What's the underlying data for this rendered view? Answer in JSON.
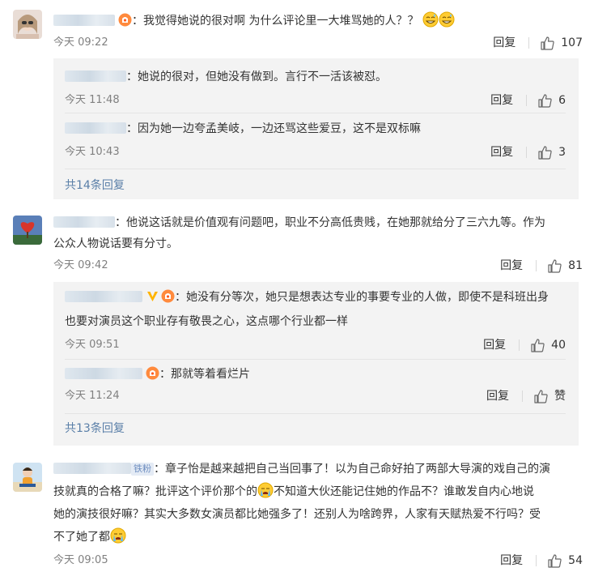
{
  "comments": [
    {
      "text": "我觉得她说的很对啊 为什么评论里一大堆骂她的人？？",
      "time": "今天 09:22",
      "reply_label": "回复",
      "likes": "107",
      "replies": [
        {
          "text": "她说的很对，但她没有做到。言行不一活该被怼。",
          "time": "今天 11:48",
          "reply_label": "回复",
          "likes": "6"
        },
        {
          "text": "因为她一边夸孟美岐，一边还骂这些爱豆，这不是双标嘛",
          "time": "今天 10:43",
          "reply_label": "回复",
          "likes": "3"
        }
      ],
      "more": "共14条回复"
    },
    {
      "text_line1": "他说这话就是价值观有问题吧，职业不分高低贵贱，在她那就给分了三六九等。作为",
      "text_line2": "公众人物说话要有分寸。",
      "time": "今天 09:42",
      "reply_label": "回复",
      "likes": "81",
      "replies": [
        {
          "text_line1": "她没有分等次，她只是想表达专业的事要专业的人做，即使不是科班出身",
          "text_line2": "也要对演员这个职业存有敬畏之心，这点哪个行业都一样",
          "time": "今天 09:51",
          "reply_label": "回复",
          "likes": "40"
        },
        {
          "text": "那就等着看烂片",
          "time": "今天 11:24",
          "reply_label": "回复",
          "likes": "赞"
        }
      ],
      "more": "共13条回复"
    },
    {
      "badge": "铁粉",
      "text_line1": "章子怡是越来越把自己当回事了！以为自己命好拍了两部大导演的戏自己的演",
      "text_line2a": "技就真的合格了嘛？批评这个评价那个的",
      "text_line2b": "不知道大伙还能记住她的作品不？谁敢发自内心地说",
      "text_line3": "她的演技很好嘛？其实大多数女演员都比她强多了！还别人为啥跨界，人家有天赋热爱不行吗？受",
      "text_line4": "不了她了都",
      "time": "今天 09:05",
      "reply_label": "回复",
      "likes": "54"
    }
  ],
  "colors": {
    "link": "#5a7fa8",
    "reply_bg": "#f3f3f3",
    "meta": "#808080"
  },
  "icons": [
    "thumbs-up-icon",
    "fan-badge-icon",
    "vip-v-icon",
    "sweat-smile-emoji",
    "crying-emoji"
  ]
}
